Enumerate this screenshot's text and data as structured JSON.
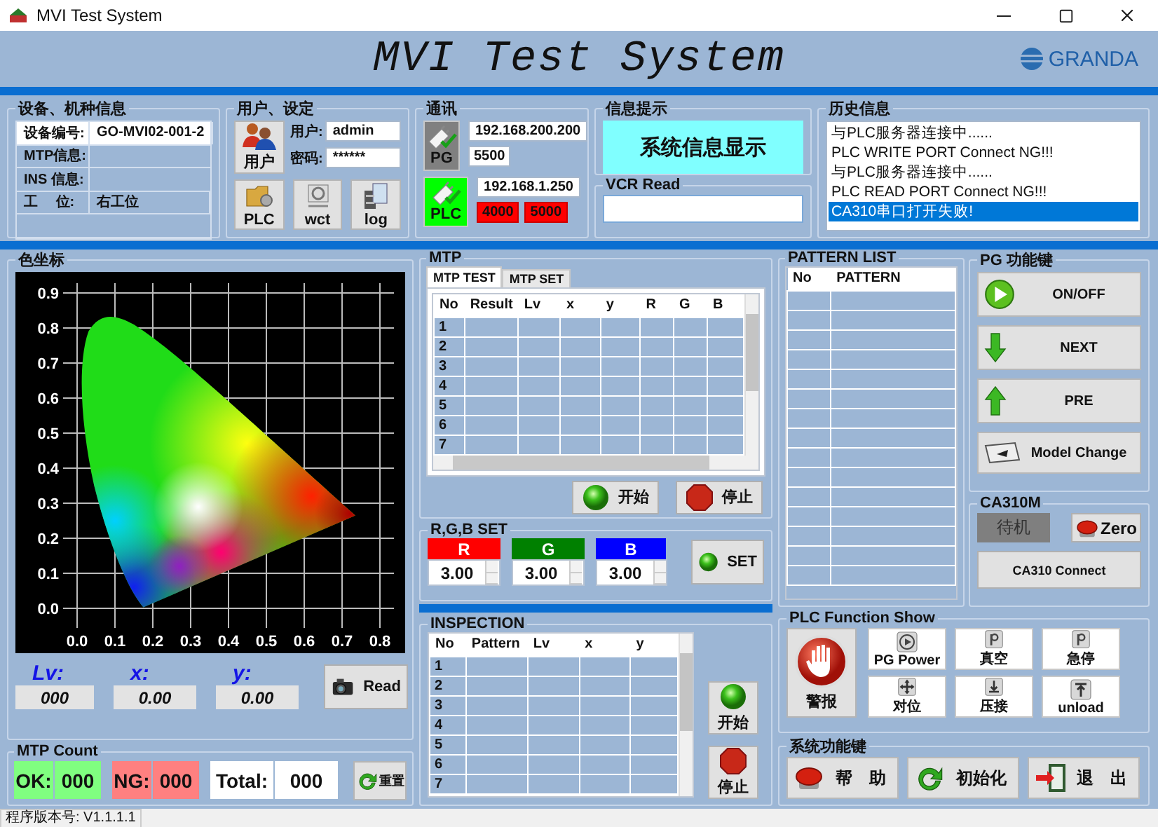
{
  "window": {
    "title": "MVI Test System"
  },
  "header": {
    "title": "MVI Test System",
    "logo": "GRANDA"
  },
  "device_info": {
    "title": "设备、机种信息",
    "rows": [
      {
        "label": "设备编号:",
        "value": "GO-MVI02-001-2",
        "selected": true
      },
      {
        "label": "MTP信息:",
        "selected": false
      },
      {
        "label": "INS 信息:",
        "selected": false
      },
      {
        "label": "工　 位:",
        "value": "右工位",
        "selected": false
      }
    ]
  },
  "user_settings": {
    "title": "用户、设定",
    "user_button": "用户",
    "user_label": "用户:",
    "user": "admin",
    "password_label": "密码:",
    "password": "******",
    "buttons": [
      {
        "label": "PLC",
        "kind": "plc"
      },
      {
        "label": "wct",
        "kind": "wct"
      },
      {
        "label": "log",
        "kind": "log"
      }
    ]
  },
  "comm": {
    "title": "通讯",
    "devices": [
      {
        "label": "PG",
        "connected": false,
        "ip": "192.168.200.200",
        "ports": [
          {
            "value": "5500",
            "alarm": false
          }
        ]
      },
      {
        "label": "PLC",
        "connected": true,
        "ip": "192.168.1.250",
        "ports": [
          {
            "value": "4000",
            "alarm": true
          },
          {
            "value": "5000",
            "alarm": true
          }
        ]
      }
    ]
  },
  "info": {
    "title": "信息提示",
    "message": "系统信息显示"
  },
  "vcr": {
    "title": "VCR Read"
  },
  "history": {
    "title": "历史信息",
    "items": [
      {
        "text": "与PLC服务器连接中......",
        "selected": false
      },
      {
        "text": "PLC WRITE PORT Connect NG!!!",
        "selected": false
      },
      {
        "text": "与PLC服务器连接中......",
        "selected": false
      },
      {
        "text": "PLC READ PORT Connect NG!!!",
        "selected": false
      },
      {
        "text": "CA310串口打开失败!",
        "selected": true
      }
    ]
  },
  "chromaticity": {
    "title": "色坐标",
    "x_ticks": [
      "0.0",
      "0.1",
      "0.2",
      "0.3",
      "0.4",
      "0.5",
      "0.6",
      "0.7",
      "0.8"
    ],
    "y_ticks": [
      "0.9",
      "0.8",
      "0.7",
      "0.6",
      "0.5",
      "0.4",
      "0.3",
      "0.2",
      "0.1",
      "0.0"
    ],
    "readings": [
      {
        "label": "Lv:",
        "value": "000"
      },
      {
        "label": "x:",
        "value": "0.00"
      },
      {
        "label": "y:",
        "value": "0.00"
      }
    ],
    "read_button": "Read"
  },
  "mtp_count": {
    "title": "MTP Count",
    "items": [
      {
        "label": "OK:",
        "value": "000",
        "color": "#80ff80"
      },
      {
        "label": "NG:",
        "value": "000",
        "color": "#ff8080"
      },
      {
        "label": "Total:",
        "value": "000",
        "color": "#ffffff"
      }
    ],
    "reset_button": "重置"
  },
  "mtp": {
    "title": "MTP",
    "tabs": [
      {
        "label": "MTP TEST",
        "selected": true
      },
      {
        "label": "MTP SET",
        "selected": false
      }
    ],
    "columns": [
      "No",
      "Result",
      "Lv",
      "x",
      "y",
      "R",
      "G",
      "B"
    ],
    "rows": [
      "1",
      "2",
      "3",
      "4",
      "5",
      "6",
      "7"
    ],
    "buttons": [
      {
        "label": "开始",
        "kind": "start"
      },
      {
        "label": "停止",
        "kind": "stop"
      }
    ]
  },
  "rgb_set": {
    "title": "R,G,B SET",
    "channels": [
      {
        "name": "R",
        "value": "3.00",
        "color": "#ff0000"
      },
      {
        "name": "G",
        "value": "3.00",
        "color": "#008000"
      },
      {
        "name": "B",
        "value": "3.00",
        "color": "#0000ff"
      }
    ],
    "button": "SET"
  },
  "inspection": {
    "title": "INSPECTION",
    "columns": [
      "No",
      "Pattern",
      "Lv",
      "x",
      "y"
    ],
    "rows": [
      "1",
      "2",
      "3",
      "4",
      "5",
      "6",
      "7"
    ],
    "buttons": [
      {
        "label": "开始",
        "kind": "start"
      },
      {
        "label": "停止",
        "kind": "stop"
      }
    ]
  },
  "pattern_list": {
    "title": "PATTERN LIST",
    "columns": [
      "No",
      "PATTERN"
    ]
  },
  "pg_keys": {
    "title": "PG 功能键",
    "buttons": [
      {
        "label": "ON/OFF",
        "kind": "play"
      },
      {
        "label": "NEXT",
        "kind": "down"
      },
      {
        "label": "PRE",
        "kind": "up"
      },
      {
        "label": "Model Change",
        "kind": "model"
      }
    ]
  },
  "ca310m": {
    "title": "CA310M",
    "status": "待机",
    "zero_button": "Zero",
    "connect_button": "CA310 Connect"
  },
  "plc_functions": {
    "title": "PLC Function Show",
    "alarm_button": "警报",
    "buttons": [
      {
        "label": "PG Power",
        "kind": "power"
      },
      {
        "label": "真空",
        "kind": "key"
      },
      {
        "label": "急停",
        "kind": "key"
      },
      {
        "label": "对位",
        "kind": "move"
      },
      {
        "label": "压接",
        "kind": "press"
      },
      {
        "label": "unload",
        "kind": "unload"
      }
    ]
  },
  "system_keys": {
    "title": "系统功能键",
    "buttons": [
      {
        "label": "帮　助",
        "kind": "help"
      },
      {
        "label": "初始化",
        "kind": "init"
      },
      {
        "label": "退　出",
        "kind": "exit"
      }
    ]
  },
  "status_bar": {
    "version": "程序版本号: V1.1.1.1"
  }
}
